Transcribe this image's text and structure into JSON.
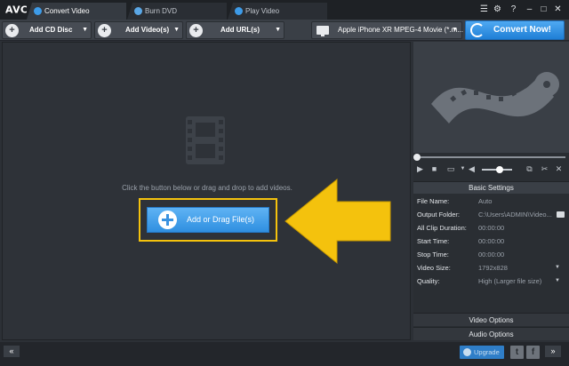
{
  "app": {
    "logo": "AVC",
    "logo_badge": "®"
  },
  "tabs": [
    {
      "label": "Convert Video",
      "active": true,
      "icon": "convert-icon"
    },
    {
      "label": "Burn DVD",
      "active": false,
      "icon": "disc-icon"
    },
    {
      "label": "Play Video",
      "active": false,
      "icon": "play-icon"
    }
  ],
  "window_controls": {
    "list": "☰",
    "settings": "⚙",
    "help": "?",
    "minimize": "–",
    "maximize": "□",
    "close": "✕"
  },
  "toolbar": {
    "add_cd": "Add CD Disc",
    "add_videos": "Add Video(s)",
    "add_url": "Add URL(s)",
    "profile": "Apple iPhone XR MPEG-4 Movie (*.m...",
    "convert": "Convert Now!"
  },
  "main": {
    "hint": "Click the button below or drag and drop to add videos.",
    "add_button": "Add or Drag File(s)"
  },
  "player": {
    "seek_position": 0,
    "volume": 0.6
  },
  "settings": {
    "header": "Basic Settings",
    "rows": [
      {
        "key": "File Name:",
        "value": "Auto"
      },
      {
        "key": "Output Folder:",
        "value": "C:\\Users\\ADMIN\\Video..."
      },
      {
        "key": "All Clip Duration:",
        "value": "00:00:00"
      },
      {
        "key": "Start Time:",
        "value": "00:00:00"
      },
      {
        "key": "Stop Time:",
        "value": "00:00:00"
      },
      {
        "key": "Video Size:",
        "value": "1792x828"
      },
      {
        "key": "Quality:",
        "value": "High (Larger file size)"
      }
    ],
    "video_options": "Video Options",
    "audio_options": "Audio Options"
  },
  "bottom": {
    "collapse": "«",
    "upgrade": "Upgrade",
    "twitter": "t",
    "facebook": "f",
    "expand": "»"
  },
  "colors": {
    "accent": "#2f8fe0",
    "highlight": "#f4c20d",
    "background": "#2e3238"
  }
}
